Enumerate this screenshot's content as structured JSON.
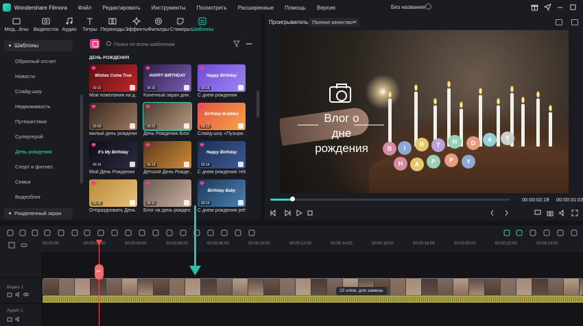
{
  "titlebar": {
    "app_name": "Wondershare Filmora",
    "menu": [
      "Файл",
      "Редактировать",
      "Инструменты",
      "Посмотреть",
      "Расширенные",
      "Помощь",
      "Версия"
    ],
    "project_title": "Без названия"
  },
  "media_tabs": [
    {
      "label": "Мед...йлы",
      "icon": "media-icon"
    },
    {
      "label": "Видеосток",
      "icon": "stock-video-icon"
    },
    {
      "label": "Аудио",
      "icon": "music-note-icon"
    },
    {
      "label": "Титры",
      "icon": "text-icon"
    },
    {
      "label": "Переходы",
      "icon": "transition-icon"
    },
    {
      "label": "Эффекты",
      "icon": "effects-icon"
    },
    {
      "label": "Фильтры",
      "icon": "filter-icon"
    },
    {
      "label": "Стикеры",
      "icon": "sticker-icon"
    },
    {
      "label": "Шаблоны",
      "icon": "template-icon",
      "active": true
    }
  ],
  "sidebar": {
    "header": "Шаблоны",
    "items": [
      "Обратный отсчет",
      "Новости",
      "Слайд-шоу",
      "Недвижимость",
      "Путешествие",
      "Супергерой",
      "День рождения",
      "Спорт и фитнес",
      "Семья",
      "Видеоблог"
    ],
    "active": "День рождения",
    "footer": "Разделенный экран"
  },
  "templates": {
    "search_placeholder": "Поиск по всем шаблонам",
    "section_title": "ДЕНЬ РОЖДЕНИЯ",
    "cards": [
      {
        "label": "Мои пожелания на д...",
        "duration": "00:10",
        "thumb_text": "Wishes Come True",
        "colors": [
          "#5a0f12",
          "#c2262a"
        ]
      },
      {
        "label": "Конечный экран дня ...",
        "duration": "00:15",
        "thumb_text": "HAPPY BIRTHDAY",
        "colors": [
          "#2b1f4a",
          "#7a5fb3"
        ]
      },
      {
        "label": "С днем рождения",
        "duration": "00:15",
        "thumb_text": "Happy Birthday",
        "colors": [
          "#6c4bd8",
          "#9f86f0"
        ]
      },
      {
        "label": "милый день рождения",
        "duration": "00:09",
        "thumb_text": "",
        "colors": [
          "#3a2a22",
          "#9d7a5d"
        ]
      },
      {
        "label": "День Рождения Влог",
        "duration": "00:31",
        "thumb_text": "",
        "colors": [
          "#4a3a30",
          "#b79a7e"
        ],
        "selected": true
      },
      {
        "label": "Слайд-шоу «Пузыри ...",
        "duration": "00:12",
        "thumb_text": "Birthday Bubbles",
        "colors": [
          "#e2533f",
          "#f6a64a"
        ]
      },
      {
        "label": "Мой День Рождения",
        "duration": "00:16",
        "thumb_text": "It's My Birthday",
        "colors": [
          "#0d0d16",
          "#2c2c44"
        ]
      },
      {
        "label": "Детский День Рожде...",
        "duration": "00:19",
        "thumb_text": "",
        "colors": [
          "#5c3a1a",
          "#d08a3a"
        ]
      },
      {
        "label": "С днем рождения тебя",
        "duration": "00:14",
        "thumb_text": "Happy Birthday",
        "colors": [
          "#1d2f52",
          "#3b5a96"
        ]
      },
      {
        "label": "Отпраздновать День ...",
        "duration": "00:15",
        "thumb_text": "",
        "colors": [
          "#b88a3a",
          "#eac27a"
        ]
      },
      {
        "label": "Блог на день рожден...",
        "duration": "00:11",
        "thumb_text": "",
        "colors": [
          "#6a5b52",
          "#c9b1a1"
        ]
      },
      {
        "label": "С днем рождения ребе...",
        "duration": "00:14",
        "thumb_text": "Birthday Baby",
        "colors": [
          "#1d3a5a",
          "#4c7fb0"
        ]
      }
    ]
  },
  "player": {
    "label": "Проигрыватель",
    "quality": "Полное качество",
    "overlay_text": [
      "Влог о",
      "дне",
      "рождения"
    ],
    "balloon_letters": [
      "B",
      "I",
      "R",
      "T",
      "H",
      "D",
      "A",
      "Y",
      "H",
      "A",
      "P",
      "P",
      "Y"
    ],
    "current_time": "00:00:02:19",
    "separator": "/",
    "total_time": "00:00:31:03",
    "progress": 0.09
  },
  "timeline": {
    "ruler": [
      "00:00:00",
      "00:00:02:00",
      "00:00:04:00",
      "00:00:06:00",
      "00:00:08:00",
      "00:00:10:00",
      "00:00:12:00",
      "00:00:14:00",
      "00:00:16:00",
      "00:00:18:00",
      "00:00:20:00",
      "00:00:22:00",
      "00:00:24:00"
    ],
    "video_track": "Видео 1",
    "audio_track": "Аудио 1",
    "tooltip": "10 элем. для замены"
  },
  "colors": {
    "accent": "#2fd6b6",
    "playhead": "#ff4a4a",
    "bg": "#141418",
    "panel": "#1b1c21"
  }
}
